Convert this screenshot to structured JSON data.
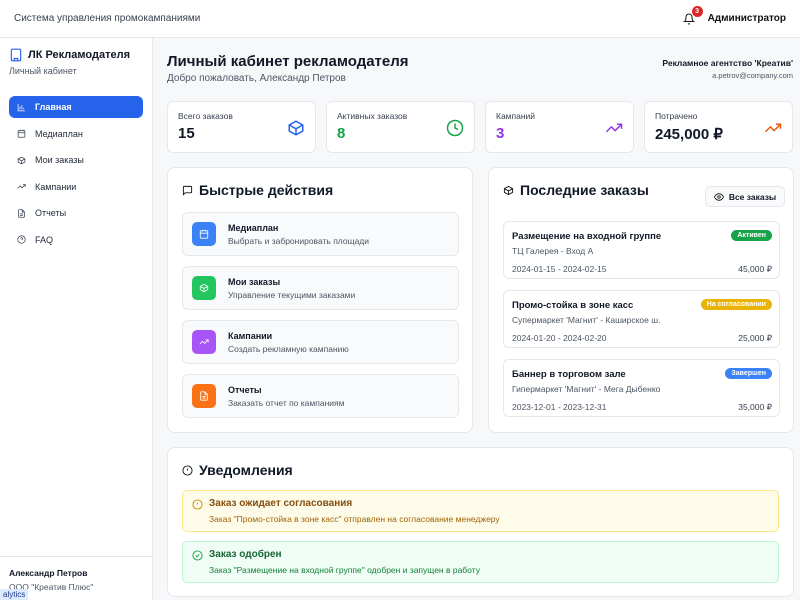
{
  "topbar": {
    "system_title": "Система управления промокампаниями",
    "notifications_count": "3",
    "user": "Администратор"
  },
  "sidebar": {
    "title": "ЛК Рекламодателя",
    "subtitle": "Личный кабинет",
    "items": [
      {
        "label": "Главная",
        "icon": "bar-chart-icon",
        "active": true
      },
      {
        "label": "Медиаплан",
        "icon": "calendar-icon",
        "active": false
      },
      {
        "label": "Мои заказы",
        "icon": "package-icon",
        "active": false
      },
      {
        "label": "Кампании",
        "icon": "trending-up-icon",
        "active": false
      },
      {
        "label": "Отчеты",
        "icon": "file-icon",
        "active": false
      },
      {
        "label": "FAQ",
        "icon": "help-circle-icon",
        "active": false
      }
    ],
    "footer_name": "Александр Петров",
    "footer_org": "ООО \"Креатив Плюс\"",
    "analytics_tag": "alytics"
  },
  "header": {
    "title": "Личный кабинет рекламодателя",
    "welcome": "Добро пожаловать, Александр Петров",
    "agency": "Рекламное агентство 'Креатив'",
    "email": "a.petrov@company.com"
  },
  "stats": [
    {
      "label": "Всего заказов",
      "value": "15",
      "color": "#111827",
      "icon": "package-icon",
      "icon_color": "#2563eb"
    },
    {
      "label": "Активных заказов",
      "value": "8",
      "color": "#16a34a",
      "icon": "clock-icon",
      "icon_color": "#16a34a"
    },
    {
      "label": "Кампаний",
      "value": "3",
      "color": "#9333ea",
      "icon": "trending-up-icon",
      "icon_color": "#9333ea"
    },
    {
      "label": "Потрачено",
      "value": "245,000 ₽",
      "color": "#111827",
      "icon": "trending-up-icon",
      "icon_color": "#ea580c"
    }
  ],
  "quick_actions": {
    "title": "Быстрые действия",
    "items": [
      {
        "title": "Медиаплан",
        "subtitle": "Выбрать и забронировать площади",
        "color": "#3b82f6",
        "icon": "calendar-icon"
      },
      {
        "title": "Мои заказы",
        "subtitle": "Управление текущими заказами",
        "color": "#22c55e",
        "icon": "package-icon"
      },
      {
        "title": "Кампании",
        "subtitle": "Создать рекламную кампанию",
        "color": "#a855f7",
        "icon": "trending-up-icon"
      },
      {
        "title": "Отчеты",
        "subtitle": "Заказать отчет по кампаниям",
        "color": "#f97316",
        "icon": "file-icon"
      }
    ]
  },
  "recent_orders": {
    "title": "Последние заказы",
    "all_button": "Все заказы",
    "items": [
      {
        "title": "Размещение на входной группе",
        "location": "ТЦ Галерея - Вход А",
        "dates": "2024-01-15 - 2024-02-15",
        "price": "45,000 ₽",
        "status": "Активен",
        "status_bg": "#16a34a",
        "status_fg": "#ffffff"
      },
      {
        "title": "Промо-стойка в зоне касс",
        "location": "Супермаркет 'Магнит' - Каширское ш.",
        "dates": "2024-01-20 - 2024-02-20",
        "price": "25,000 ₽",
        "status": "На согласовании",
        "status_bg": "#eab308",
        "status_fg": "#ffffff"
      },
      {
        "title": "Баннер в торговом зале",
        "location": "Гипермаркет 'Магнит' - Мега Дыбенко",
        "dates": "2023-12-01 - 2023-12-31",
        "price": "35,000 ₽",
        "status": "Завершен",
        "status_bg": "#3b82f6",
        "status_fg": "#ffffff"
      }
    ]
  },
  "notifications": {
    "title": "Уведомления",
    "items": [
      {
        "title": "Заказ ожидает согласования",
        "text": "Заказ \"Промо-стойка в зоне касс\" отправлен на согласование менеджеру",
        "bg": "#fefce8",
        "border": "#fde68a",
        "title_color": "#854d0e",
        "text_color": "#a16207",
        "icon": "alert-circle-icon",
        "icon_color": "#ca8a04"
      },
      {
        "title": "Заказ одобрен",
        "text": "Заказ \"Размещение на входной группе\" одобрен и запущен в работу",
        "bg": "#f0fdf4",
        "border": "#bbf7d0",
        "title_color": "#166534",
        "text_color": "#15803d",
        "icon": "check-circle-icon",
        "icon_color": "#16a34a"
      }
    ]
  }
}
